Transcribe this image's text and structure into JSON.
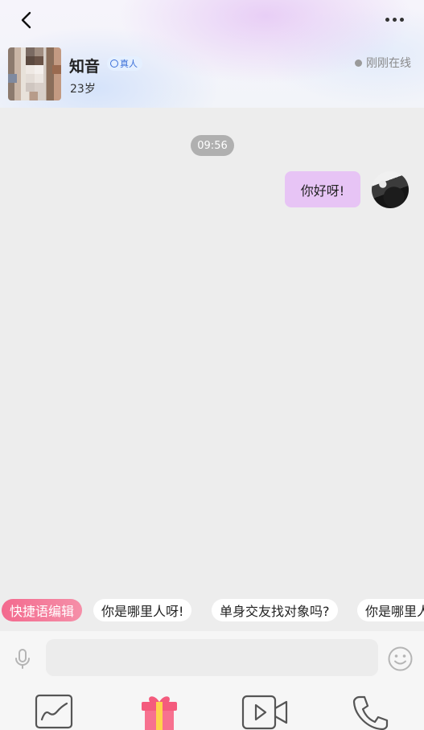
{
  "header": {
    "name": "知音",
    "verified_label": "真人",
    "age": "23岁",
    "status": "刚刚在线"
  },
  "chat": {
    "timestamp": "09:56",
    "messages": [
      {
        "from": "me",
        "text": "你好呀!"
      }
    ]
  },
  "quick_phrases": {
    "edit_label": "快捷语编辑",
    "items": [
      "你是哪里人呀!",
      "单身交友找对象吗?",
      "你是哪里人"
    ]
  },
  "input": {
    "placeholder": ""
  },
  "colors": {
    "bubble": "#e7c4f5",
    "accent_pink": "#f36a8e",
    "verified_blue": "#3a6fd8"
  },
  "icons": {
    "back": "chevron-left-icon",
    "more": "more-dots-icon",
    "mic": "microphone-icon",
    "emoji": "smiley-icon",
    "photo": "image-icon",
    "gift": "gift-icon",
    "video": "video-camera-icon",
    "call": "phone-icon"
  }
}
